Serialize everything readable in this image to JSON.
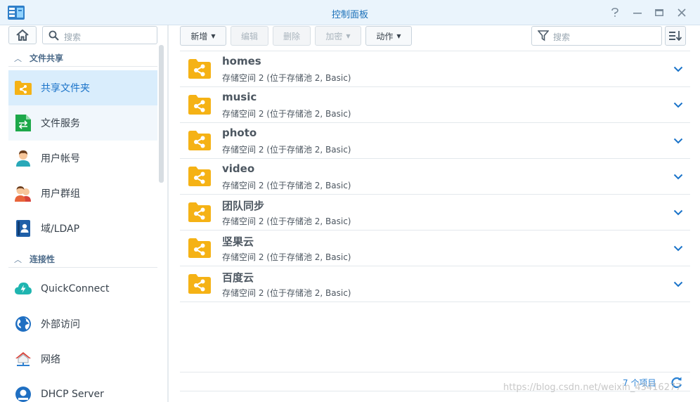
{
  "window": {
    "title": "控制面板",
    "help_label": "?",
    "minimize_label": "—",
    "maximize_label": "▭",
    "close_label": "✕"
  },
  "sidebar": {
    "search_placeholder": "搜索",
    "sections": [
      {
        "label": "文件共享",
        "items": [
          {
            "label": "共享文件夹",
            "icon": "shared-folder-icon",
            "state": "selected"
          },
          {
            "label": "文件服务",
            "icon": "file-services-icon",
            "state": "hover"
          },
          {
            "label": "用户帐号",
            "icon": "user-icon"
          },
          {
            "label": "用户群组",
            "icon": "group-icon"
          },
          {
            "label": "域/LDAP",
            "icon": "domain-ldap-icon"
          }
        ]
      },
      {
        "label": "连接性",
        "items": [
          {
            "label": "QuickConnect",
            "icon": "quickconnect-icon"
          },
          {
            "label": "外部访问",
            "icon": "external-access-icon"
          },
          {
            "label": "网络",
            "icon": "network-icon"
          },
          {
            "label": "DHCP Server",
            "icon": "dhcp-server-icon"
          }
        ]
      }
    ]
  },
  "toolbar": {
    "create": "新增",
    "edit": "编辑",
    "delete": "删除",
    "encrypt": "加密",
    "action": "动作",
    "filter_placeholder": "搜索"
  },
  "folders": [
    {
      "name": "homes",
      "desc": "存储空间 2 (位于存储池 2, Basic)"
    },
    {
      "name": "music",
      "desc": "存储空间 2 (位于存储池 2, Basic)"
    },
    {
      "name": "photo",
      "desc": "存储空间 2 (位于存储池 2, Basic)"
    },
    {
      "name": "video",
      "desc": "存储空间 2 (位于存储池 2, Basic)"
    },
    {
      "name": "团队同步",
      "desc": "存储空间 2 (位于存储池 2, Basic)"
    },
    {
      "name": "坚果云",
      "desc": "存储空间 2 (位于存储池 2, Basic)"
    },
    {
      "name": "百度云",
      "desc": "存储空间 2 (位于存储池 2, Basic)"
    }
  ],
  "footer": {
    "count": "7 个项目",
    "watermark": "https://blog.csdn.net/weixin_43416277"
  },
  "colors": {
    "accent": "#1a73c9",
    "folder": "#f5b215",
    "selected_bg": "#d9edfc"
  }
}
